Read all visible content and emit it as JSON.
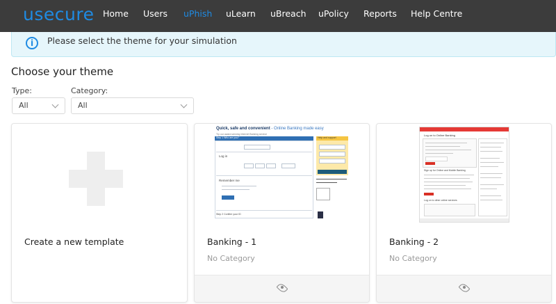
{
  "brand": {
    "logo": "usecure",
    "accent": "#1f8be3"
  },
  "nav": {
    "items": [
      {
        "label": "Home",
        "active": false
      },
      {
        "label": "Users",
        "active": false
      },
      {
        "label": "uPhish",
        "active": true
      },
      {
        "label": "uLearn",
        "active": false
      },
      {
        "label": "uBreach",
        "active": false
      },
      {
        "label": "uPolicy",
        "active": false
      },
      {
        "label": "Reports",
        "active": false
      },
      {
        "label": "Help Centre",
        "active": false
      }
    ]
  },
  "banner": {
    "icon": "info-icon",
    "text": "Please select the theme for your simulation"
  },
  "page": {
    "title": "Choose your theme"
  },
  "filters": {
    "type": {
      "label": "Type:",
      "value": "All"
    },
    "category": {
      "label": "Category:",
      "value": "All"
    }
  },
  "cards": [
    {
      "title": "Create a new template",
      "icon": "plus-icon"
    },
    {
      "title": "Banking - 1",
      "category": "No Category",
      "preview": {
        "heading": "Quick, safe and convenient",
        "heading_suffix": " - Online Banking made easy",
        "subheading": "Try our award-winning Internet Banking service",
        "step1": "Step 1   Who are you?",
        "login": "Log in",
        "remember": "Remember me",
        "step2": "Step 2   Confirm your ID",
        "help": "Help and support"
      }
    },
    {
      "title": "Banking - 2",
      "category": "No Category",
      "preview": {
        "heading": "Log on to Online Banking",
        "signup": "Sign up for Online and Mobile Banking",
        "other": "Log on to other online services"
      }
    }
  ]
}
